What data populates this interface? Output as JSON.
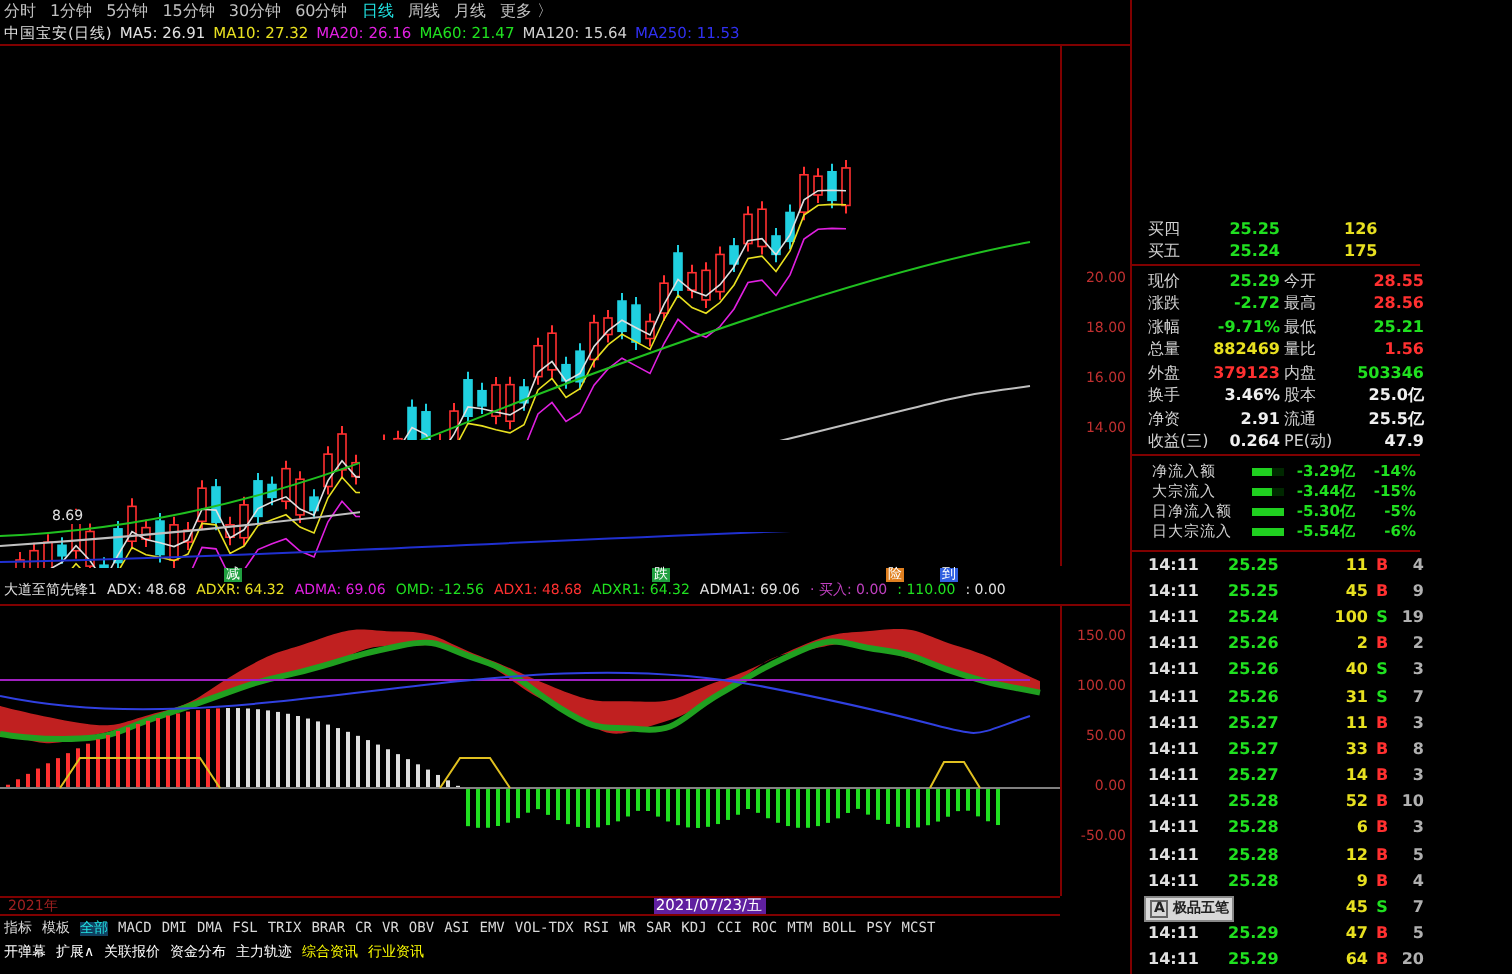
{
  "period_tabs": [
    {
      "label": "分时",
      "selected": false
    },
    {
      "label": "1分钟",
      "selected": false
    },
    {
      "label": "5分钟",
      "selected": false
    },
    {
      "label": "15分钟",
      "selected": false
    },
    {
      "label": "30分钟",
      "selected": false
    },
    {
      "label": "60分钟",
      "selected": false
    },
    {
      "label": "日线",
      "selected": true
    },
    {
      "label": "周线",
      "selected": false
    },
    {
      "label": "月线",
      "selected": false
    },
    {
      "label": "更多 〉",
      "selected": false
    }
  ],
  "ma_legend": {
    "title": "中国宝安(日线)",
    "items": [
      {
        "text": "MA5: 26.91",
        "color": "#e0e0e0"
      },
      {
        "text": "MA10: 27.32",
        "color": "#e8e020"
      },
      {
        "text": "MA20: 26.16",
        "color": "#e020e0"
      },
      {
        "text": "MA60: 21.47",
        "color": "#20e020"
      },
      {
        "text": "MA120: 15.64",
        "color": "#d0d0d0"
      },
      {
        "text": "MA250: 11.53",
        "color": "#3030f0"
      }
    ]
  },
  "price_axis": [
    "20.00",
    "18.00",
    "16.00",
    "14.00"
  ],
  "low_marker": "8.69",
  "indicator": {
    "signals": [
      {
        "text": "减",
        "color": "#20a040"
      },
      {
        "text": "跌",
        "color": "#20a040"
      },
      {
        "text": "险",
        "color": "#e08020"
      },
      {
        "text": "到",
        "color": "#3060e0"
      }
    ],
    "legend": [
      {
        "text": "大道至简先锋1",
        "color": "#e0e0e0"
      },
      {
        "text": "ADX: 48.68",
        "color": "#e0e0e0"
      },
      {
        "text": "ADXR: 64.32",
        "color": "#e8e020"
      },
      {
        "text": "ADMA: 69.06",
        "color": "#e020e0"
      },
      {
        "text": "OMD: -12.56",
        "color": "#20e020"
      },
      {
        "text": "ADX1: 48.68",
        "color": "#ff3030"
      },
      {
        "text": "ADXR1: 64.32",
        "color": "#20e020"
      },
      {
        "text": "ADMA1: 69.06",
        "color": "#e0e0e0"
      },
      {
        "text": "· 买入: 0.00",
        "color": "#c040c0"
      },
      {
        "text": ": 110.00",
        "color": "#20e020"
      },
      {
        "text": ": 0.00",
        "color": "#e0e0e0"
      }
    ],
    "axis": [
      "150.00",
      "100.00",
      "50.00",
      "0.00",
      "-50.00"
    ]
  },
  "date_axis": {
    "year": "2021年",
    "cursor_date": "2021/07/23/五"
  },
  "index_tabs": [
    {
      "label": "指标",
      "selected": false
    },
    {
      "label": "模板",
      "selected": false
    },
    {
      "label": "全部",
      "selected": true
    },
    {
      "label": "MACD",
      "selected": false
    },
    {
      "label": "DMI",
      "selected": false
    },
    {
      "label": "DMA",
      "selected": false
    },
    {
      "label": "FSL",
      "selected": false
    },
    {
      "label": "TRIX",
      "selected": false
    },
    {
      "label": "BRAR",
      "selected": false
    },
    {
      "label": "CR",
      "selected": false
    },
    {
      "label": "VR",
      "selected": false
    },
    {
      "label": "OBV",
      "selected": false
    },
    {
      "label": "ASI",
      "selected": false
    },
    {
      "label": "EMV",
      "selected": false
    },
    {
      "label": "VOL-TDX",
      "selected": false
    },
    {
      "label": "RSI",
      "selected": false
    },
    {
      "label": "WR",
      "selected": false
    },
    {
      "label": "SAR",
      "selected": false
    },
    {
      "label": "KDJ",
      "selected": false
    },
    {
      "label": "CCI",
      "selected": false
    },
    {
      "label": "ROC",
      "selected": false
    },
    {
      "label": "MTM",
      "selected": false
    },
    {
      "label": "BOLL",
      "selected": false
    },
    {
      "label": "PSY",
      "selected": false
    },
    {
      "label": "MCST",
      "selected": false
    }
  ],
  "bottom_tabs": [
    {
      "label": "开弹幕",
      "kind": "plain"
    },
    {
      "label": "扩展∧",
      "kind": "plain"
    },
    {
      "label": "关联报价",
      "kind": "plain"
    },
    {
      "label": "资金分布",
      "kind": "plain"
    },
    {
      "label": "主力轨迹",
      "kind": "plain"
    },
    {
      "label": "综合资讯",
      "kind": "news"
    },
    {
      "label": "行业资讯",
      "kind": "news"
    }
  ],
  "bids": [
    {
      "label": "买四",
      "price": "25.25",
      "volume": "126"
    },
    {
      "label": "买五",
      "price": "25.24",
      "volume": "175"
    }
  ],
  "quotes": [
    {
      "cells": [
        {
          "label": "现价",
          "value": "25.29",
          "color": "#20e020"
        },
        {
          "label": "今开",
          "value": "28.55",
          "color": "#ff3030"
        }
      ]
    },
    {
      "cells": [
        {
          "label": "涨跌",
          "value": "-2.72",
          "color": "#20e020"
        },
        {
          "label": "最高",
          "value": "28.56",
          "color": "#ff3030"
        }
      ]
    },
    {
      "cells": [
        {
          "label": "涨幅",
          "value": "-9.71%",
          "color": "#20e020"
        },
        {
          "label": "最低",
          "value": "25.21",
          "color": "#20e020"
        }
      ]
    },
    {
      "cells": [
        {
          "label": "总量",
          "value": "882469",
          "color": "#e8e020"
        },
        {
          "label": "量比",
          "value": "1.56",
          "color": "#ff3030"
        }
      ]
    },
    {
      "cells": [
        {
          "label": "外盘",
          "value": "379123",
          "color": "#ff3030"
        },
        {
          "label": "内盘",
          "value": "503346",
          "color": "#20e020"
        }
      ]
    },
    {
      "cells": [
        {
          "label": "换手",
          "value": "3.46%",
          "color": "#f0f0f0"
        },
        {
          "label": "股本",
          "value": "25.0亿",
          "color": "#f0f0f0"
        }
      ]
    },
    {
      "cells": [
        {
          "label": "净资",
          "value": "2.91",
          "color": "#f0f0f0"
        },
        {
          "label": "流通",
          "value": "25.5亿",
          "color": "#f0f0f0"
        }
      ]
    },
    {
      "cells": [
        {
          "label": "收益(三)",
          "value": "0.264",
          "color": "#f0f0f0"
        },
        {
          "label": "PE(动)",
          "value": "47.9",
          "color": "#f0f0f0"
        }
      ]
    }
  ],
  "fund_flows": [
    {
      "label": "净流入额",
      "level": 0.65,
      "amount": "-3.29亿",
      "percent": "-14%"
    },
    {
      "label": "大宗流入",
      "level": 0.65,
      "amount": "-3.44亿",
      "percent": "-15%"
    },
    {
      "label": "日净流入额",
      "level": 1,
      "amount": "-5.30亿",
      "percent": "-5%"
    },
    {
      "label": "日大宗流入",
      "level": 1,
      "amount": "-5.54亿",
      "percent": "-6%"
    }
  ],
  "trades": [
    {
      "time": "14:11",
      "price": "25.25",
      "volume": "11",
      "side": "B",
      "kind": "buy",
      "count": "4"
    },
    {
      "time": "14:11",
      "price": "25.25",
      "volume": "45",
      "side": "B",
      "kind": "buy",
      "count": "9"
    },
    {
      "time": "14:11",
      "price": "25.24",
      "volume": "100",
      "side": "S",
      "kind": "sell",
      "count": "19"
    },
    {
      "time": "14:11",
      "price": "25.26",
      "volume": "2",
      "side": "B",
      "kind": "buy",
      "count": "2"
    },
    {
      "time": "14:11",
      "price": "25.26",
      "volume": "40",
      "side": "S",
      "kind": "sell",
      "count": "3"
    },
    {
      "time": "14:11",
      "price": "25.26",
      "volume": "31",
      "side": "S",
      "kind": "sell",
      "count": "7"
    },
    {
      "time": "14:11",
      "price": "25.27",
      "volume": "11",
      "side": "B",
      "kind": "buy",
      "count": "3"
    },
    {
      "time": "14:11",
      "price": "25.27",
      "volume": "33",
      "side": "B",
      "kind": "buy",
      "count": "8"
    },
    {
      "time": "14:11",
      "price": "25.27",
      "volume": "14",
      "side": "B",
      "kind": "buy",
      "count": "3"
    },
    {
      "time": "14:11",
      "price": "25.28",
      "volume": "52",
      "side": "B",
      "kind": "buy",
      "count": "10"
    },
    {
      "time": "14:11",
      "price": "25.28",
      "volume": "6",
      "side": "B",
      "kind": "buy",
      "count": "3"
    },
    {
      "time": "14:11",
      "price": "25.28",
      "volume": "12",
      "side": "B",
      "kind": "buy",
      "count": "5"
    },
    {
      "time": "14:11",
      "price": "25.28",
      "volume": "9",
      "side": "B",
      "kind": "buy",
      "count": "4"
    },
    {
      "volume": "45",
      "side": "S",
      "kind": "sell",
      "count": "7"
    },
    {
      "time": "14:11",
      "price": "25.29",
      "volume": "47",
      "side": "B",
      "kind": "buy",
      "count": "5"
    },
    {
      "time": "14:11",
      "price": "25.29",
      "volume": "64",
      "side": "B",
      "kind": "buy",
      "count": "20"
    }
  ],
  "ime_bar": {
    "mode": "A",
    "name": "极品五笔"
  }
}
